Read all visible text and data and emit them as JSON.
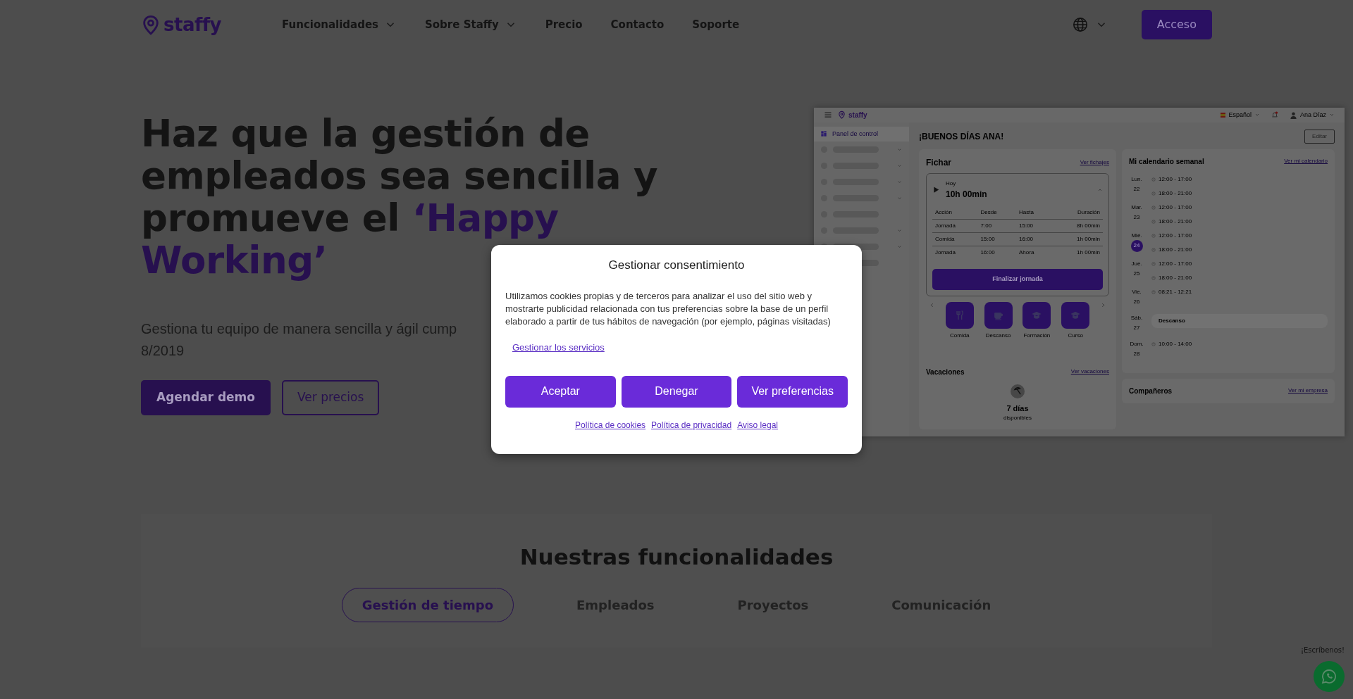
{
  "header": {
    "logo": "staffy",
    "nav": [
      {
        "label": "Funcionalidades",
        "dropdown": true
      },
      {
        "label": "Sobre Staffy",
        "dropdown": true
      },
      {
        "label": "Precio",
        "dropdown": false
      },
      {
        "label": "Contacto",
        "dropdown": false
      },
      {
        "label": "Soporte",
        "dropdown": false
      }
    ],
    "login_button": "Acceso"
  },
  "hero": {
    "title_lines": [
      [
        {
          "text": "Haz que la gestión de",
          "highlight": false
        }
      ],
      [
        {
          "text": "empleados sea sencilla y",
          "highlight": false
        }
      ],
      [
        {
          "text": "promueve el ",
          "highlight": false
        },
        {
          "text": "‘Happy",
          "highlight": true
        }
      ],
      [
        {
          "text": "Working’",
          "highlight": true
        }
      ]
    ],
    "subtitle_lines": [
      "Gestiona tu equipo de manera sencilla y ágil cump",
      "8/2019"
    ],
    "primary_button": "Agendar demo",
    "secondary_button": "Ver precios"
  },
  "app_preview": {
    "logo": "staffy",
    "language": "Español",
    "user": "Ana Díaz",
    "sidebar_active": "Panel de control",
    "greeting": "¡BUENOS DÍAS ANA!",
    "edit_button": "Editar",
    "clock_in": {
      "title": "Fichar",
      "link": "Ver fichajes",
      "today_label": "Hoy",
      "today_total": "10h 00min",
      "columns": [
        "Acción",
        "Desde",
        "Hasta",
        "Duración"
      ],
      "rows": [
        [
          "Jornada",
          "7:00",
          "15:00",
          "8h 00min"
        ],
        [
          "Comida",
          "15:00",
          "16:00",
          "1h 00min"
        ],
        [
          "Jornada",
          "16:00",
          "Ahora",
          "1h 00min"
        ]
      ],
      "end_button": "Finalizar jornada",
      "actions": [
        {
          "kind": "meal",
          "label": "Comida"
        },
        {
          "kind": "break",
          "label": "Descanso"
        },
        {
          "kind": "training",
          "label": "Formación"
        },
        {
          "kind": "training",
          "label": "Curso"
        }
      ]
    },
    "vacations": {
      "title": "Vacaciones",
      "link": "Ver vacaciones",
      "days": "7 días",
      "caption": "disponibles"
    },
    "calendar": {
      "title": "Mi calendario semanal",
      "link": "Ver mi calendario",
      "days": [
        {
          "weekday": "Lun.",
          "date": "22",
          "selected": false,
          "shifts": [
            "12:00 - 17:00",
            "18:00 - 21:00"
          ]
        },
        {
          "weekday": "Mar.",
          "date": "23",
          "selected": false,
          "shifts": [
            "12:00 - 17:00",
            "18:00 - 21:00"
          ]
        },
        {
          "weekday": "Mié.",
          "date": "24",
          "selected": true,
          "shifts": [
            "12:00 - 17:00",
            "18:00 - 21:00"
          ]
        },
        {
          "weekday": "Jue.",
          "date": "25",
          "selected": false,
          "shifts": [
            "12:00 - 17:00",
            "18:00 - 21:00"
          ]
        },
        {
          "weekday": "Vie.",
          "date": "26",
          "selected": false,
          "shifts": [
            "08:21 - 12:21"
          ]
        },
        {
          "weekday": "Sáb.",
          "date": "27",
          "selected": false,
          "rest": "Descanso"
        },
        {
          "weekday": "Dom.",
          "date": "28",
          "selected": false,
          "shifts": [
            "10:00 - 14:00"
          ]
        }
      ]
    },
    "colleagues": {
      "title": "Compañeros",
      "link": "Ver mi empresa"
    }
  },
  "cookie_modal": {
    "title": "Gestionar consentimiento",
    "text": "Utilizamos cookies propias y de terceros para analizar el uso del sitio web y mostrarte publicidad relacionada con tus preferencias sobre la base de un perfil elaborado a partir de tus hábitos de navegación (por ejemplo, páginas visitadas)",
    "services_link": "Gestionar los servicios",
    "buttons": [
      "Aceptar",
      "Denegar",
      "Ver preferencias"
    ],
    "footer_links": [
      "Política de cookies",
      "Política de privacidad",
      "Aviso legal"
    ]
  },
  "features": {
    "title": "Nuestras funcionalidades",
    "tabs": [
      {
        "label": "Gestión de tiempo",
        "selected": true
      },
      {
        "label": "Empleados",
        "selected": false
      },
      {
        "label": "Proyectos",
        "selected": false
      },
      {
        "label": "Comunicación",
        "selected": false
      }
    ]
  },
  "chat": {
    "label": "¡Escríbenos!"
  }
}
